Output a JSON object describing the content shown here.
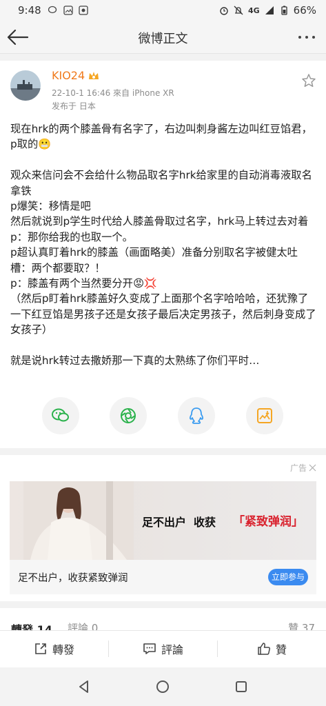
{
  "status_bar": {
    "time": "9:48",
    "network": "4G",
    "battery": "66%",
    "icons_left": [
      "wechat-icon",
      "gallery-icon",
      "photo-icon"
    ],
    "icons_right": [
      "alarm-icon",
      "mute-icon",
      "signal-icon",
      "battery-icon"
    ]
  },
  "nav": {
    "title": "微博正文",
    "back_icon": "arrow-left-icon",
    "more_icon": "more-dots-icon"
  },
  "post": {
    "username": "KIO24",
    "badge_icon": "crown-badge-icon",
    "meta_line": "22-10-1 16:46  來自 iPhone XR",
    "location_line": "发布于 日本",
    "content": "现在hrk的两个膝盖骨有名字了，右边叫刺身酱左边叫红豆馅君，p取的😬\n\n观众来信问会不会给什么物品取名字hrk给家里的自动消毒液取名拿铁\np爆笑：移情是吧\n然后就说到p学生时代给人膝盖骨取过名字，hrk马上转过去对着p：那你给我的也取一个。\np超认真盯着hrk的膝盖（画面略美）准备分别取名字被健太吐槽：两个都要取？！\np：膝盖有两个当然要分开😡💢\n（然后p盯着hrk膝盖好久变成了上面那个名字哈哈哈，还犹豫了一下红豆馅是男孩子还是女孩子最后决定男孩子，然后刺身变成了女孩子）\n\n就是说hrk转过去撒娇那一下真的太熟练了你们平时…",
    "share_buttons": [
      {
        "name": "share-wechat-button",
        "icon": "wechat-icon",
        "color": "#2bb24c"
      },
      {
        "name": "share-moments-button",
        "icon": "moments-icon",
        "color": "#2bb24c"
      },
      {
        "name": "share-qq-button",
        "icon": "qq-icon",
        "color": "#3b9cf0"
      },
      {
        "name": "save-image-button",
        "icon": "image-save-icon",
        "color": "#f5a623"
      }
    ]
  },
  "ad": {
    "tag": "广告",
    "close_icon": "close-icon",
    "slogan_a": "足不出户",
    "slogan_b": "收获",
    "slogan_c": "「紧致弹润」",
    "text": "足不出户，收获紧致弹润",
    "cta": "立即参与"
  },
  "counts": {
    "reposts": "轉發 14",
    "comments": "評論 0",
    "likes": "贊 37"
  },
  "actions": {
    "repost": "轉發",
    "comment": "評論",
    "like": "贊"
  },
  "system_nav": [
    "back-triangle-icon",
    "home-circle-icon",
    "recents-square-icon"
  ],
  "colors": {
    "username": "#f07a1c",
    "accent_blue": "#3b8bf0",
    "ad_red": "#d9222e"
  }
}
